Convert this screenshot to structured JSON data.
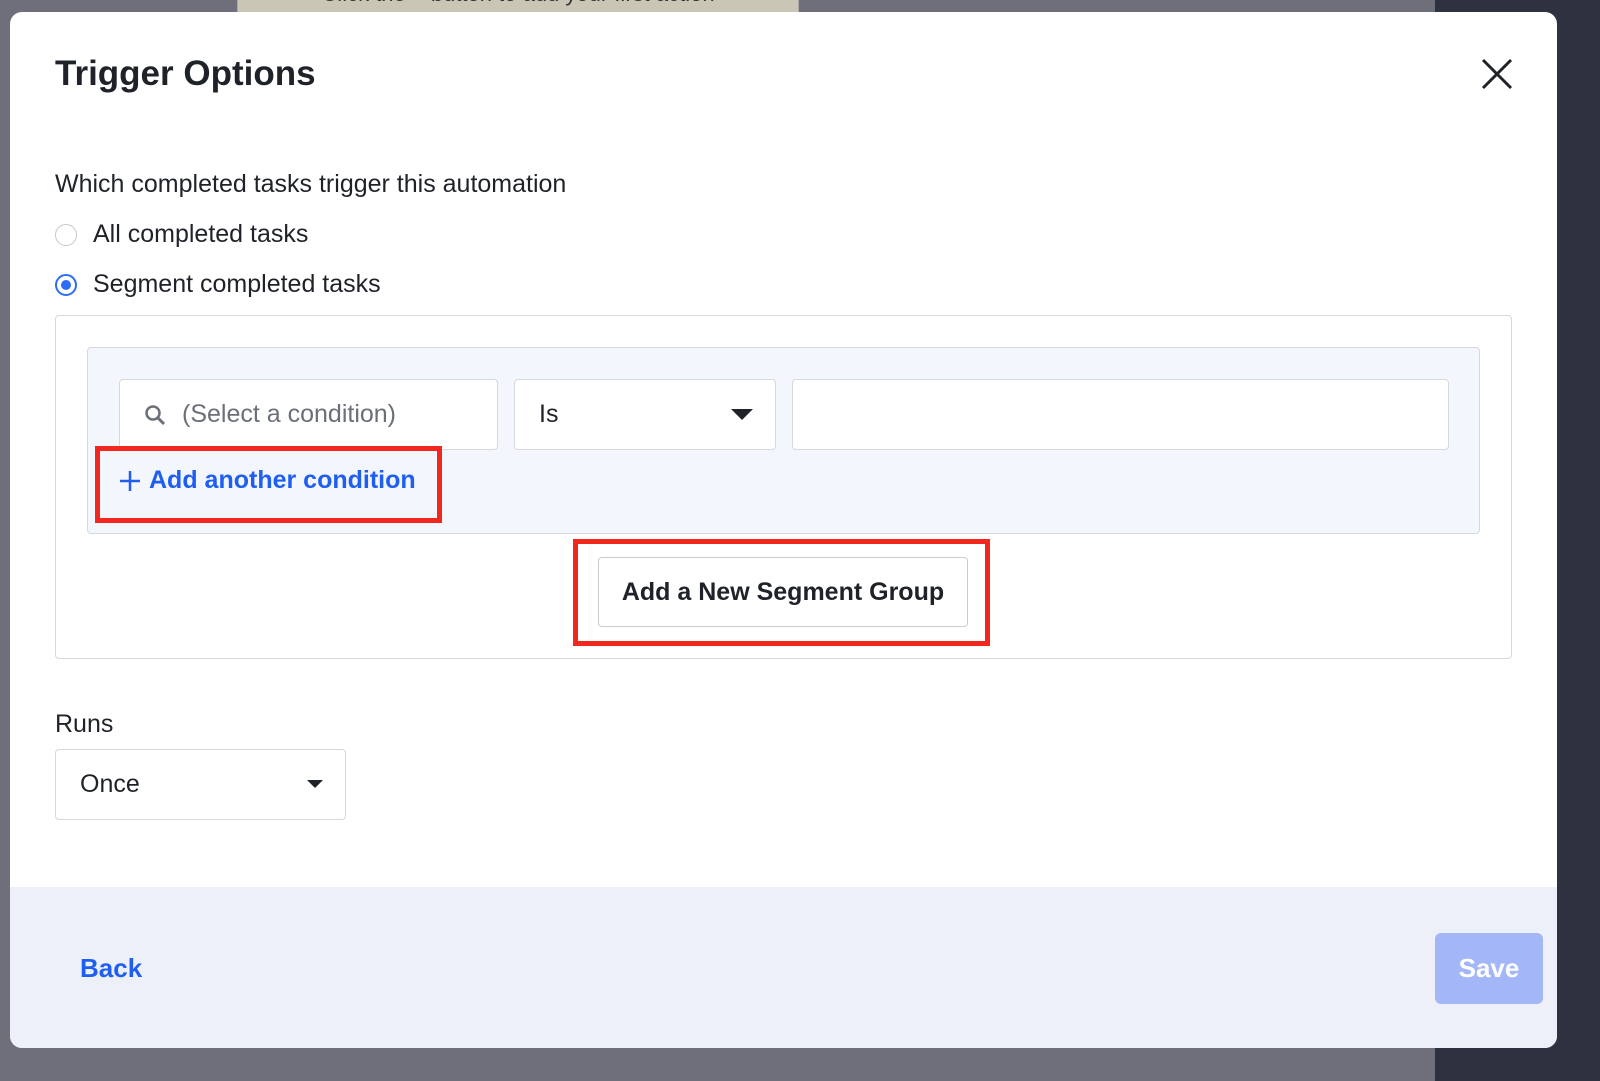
{
  "background": {
    "note": "Click the + button to add your first action"
  },
  "modal": {
    "title": "Trigger Options",
    "question": "Which completed tasks trigger this automation",
    "options": [
      {
        "label": "All completed tasks",
        "selected": false
      },
      {
        "label": "Segment completed tasks",
        "selected": true
      }
    ],
    "segment": {
      "condition_placeholder": "(Select a condition)",
      "operator": "Is",
      "value": "",
      "add_condition": "Add another condition",
      "add_group": "Add a New Segment Group"
    },
    "runs": {
      "label": "Runs",
      "value": "Once"
    },
    "footer": {
      "back": "Back",
      "save": "Save",
      "save_enabled": false
    }
  },
  "colors": {
    "accent": "#1e5ef0",
    "highlight": "#f2271d",
    "save_disabled": "#a3b7f8"
  }
}
